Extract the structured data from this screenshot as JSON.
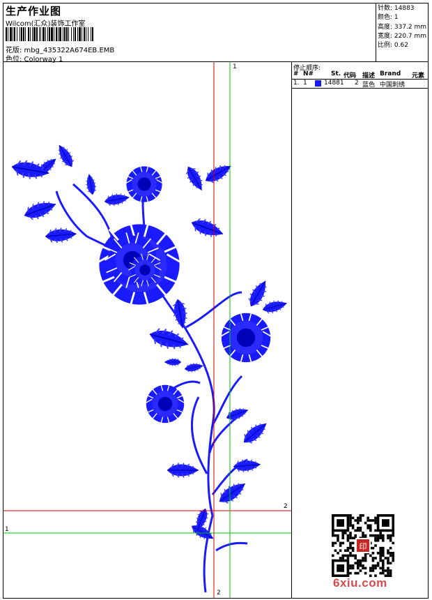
{
  "header": {
    "title": "生产作业图",
    "company": "Wilcom(汇众)装饰工作室",
    "design": "花版: mbg_435322A674EB.EMB",
    "colorway": "色位: Colorway 1"
  },
  "stats": [
    "针数: 14883",
    "颜色: 1",
    "高度: 337.2 mm",
    "宽度: 220.7 mm",
    "比例: 0.62"
  ],
  "stop_sequence": {
    "title": "停止顺序:",
    "columns": [
      "#",
      "N#",
      "St.",
      "代码",
      "描述",
      "Brand",
      "元素"
    ],
    "rows": [
      {
        "num": "1.",
        "needle": "1",
        "swatch_color": "#1a1aff",
        "stitches": "14881",
        "code": "2",
        "description": "蓝色",
        "brand": "中国刺绣"
      }
    ]
  },
  "guides": {
    "marker_1": "1",
    "marker_2": "2"
  },
  "colors": {
    "thread": "#1a1aff",
    "red_guide": "#d40000",
    "green_guide": "#00c000"
  },
  "watermark": "6xiu.com",
  "seal_text": "印"
}
